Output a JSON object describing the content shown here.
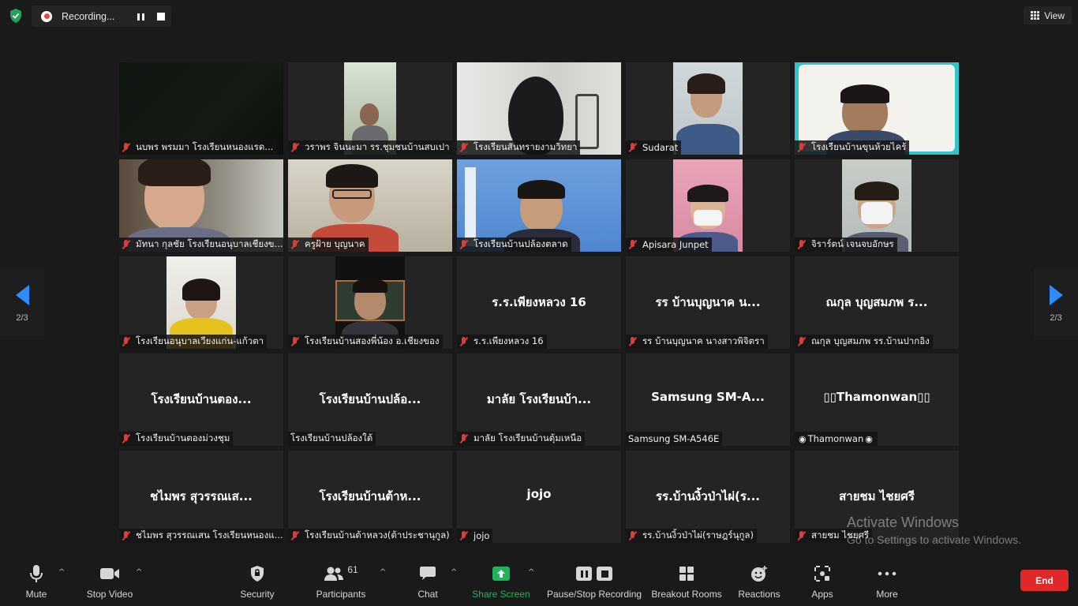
{
  "recording": {
    "label": "Recording..."
  },
  "view": {
    "label": "View"
  },
  "nav": {
    "left_page": "2/3",
    "right_page": "2/3"
  },
  "tiles": [
    {
      "label": "นบพร   พรมมา  โรงเรียนหนองแรด...",
      "big": ""
    },
    {
      "label": "วราพร จินนะมา  รร.ชุมชนบ้านสบเปา",
      "big": ""
    },
    {
      "label": "โรงเรียนสันทรายงามวิทยา",
      "big": ""
    },
    {
      "label": "Sudarat",
      "big": ""
    },
    {
      "label": "โรงเรียนบ้านขุนห้วยไคร้",
      "big": ""
    },
    {
      "label": "มัทนา กุลชัย โรงเรียนอนุบาลเชียงข...",
      "big": ""
    },
    {
      "label": "ครูฝ้าย บุญนาค",
      "big": ""
    },
    {
      "label": "โรงเรียนบ้านปล้องตลาด",
      "big": ""
    },
    {
      "label": "Apisara Junpet",
      "big": ""
    },
    {
      "label": "จิราร์ตน์ เจนจบอักษร",
      "big": ""
    },
    {
      "label": "โรงเรียนอนุบาลเวียงแก่น-แก้วตา",
      "big": ""
    },
    {
      "label": "โรงเรียนบ้านสองพี่น้อง  อ.เชียงของ",
      "big": ""
    },
    {
      "label": "ร.ร.เพียงหลวง 16",
      "big": "ร.ร.เพียงหลวง 16"
    },
    {
      "label": "รร บ้านบุญนาค นางสาวพิจิตรา",
      "big": "รร บ้านบุญนาค น..."
    },
    {
      "label": "ณกุล บุญสมภพ รร.บ้านปากอิง",
      "big": "ณกุล บุญสมภพ ร..."
    },
    {
      "label": "โรงเรียนบ้านตองม่วงชุม",
      "big": "โรงเรียนบ้านตอง..."
    },
    {
      "label": "โรงเรียนบ้านปล้องใต้",
      "big": "โรงเรียนบ้านปล้อ..."
    },
    {
      "label": "มาลัย โรงเรียนบ้านตุ้มเหนือ",
      "big": "มาลัย โรงเรียนบ้า..."
    },
    {
      "label": "Samsung SM-A546E",
      "big": "Samsung  SM-A..."
    },
    {
      "label": "Thamonwan",
      "big": "Thamonwan"
    },
    {
      "label": "ชไมพร สุวรรณเสน โรงเรียนหนองแ...",
      "big": "ชไมพร สุวรรณเส..."
    },
    {
      "label": "โรงเรียนบ้านต้าหลวง(ต้าประชานุกูล)",
      "big": "โรงเรียนบ้านต้าห..."
    },
    {
      "label": "jojo",
      "big": "jojo"
    },
    {
      "label": "รร.บ้านงิ้วป่าไผ่(ราษฎร์นุกูล)",
      "big": "รร.บ้านงิ้วป่าไผ่(ร..."
    },
    {
      "label": "สายชม ไชยศรี",
      "big": "สายชม ไชยศรี"
    }
  ],
  "toolbar": {
    "mute": "Mute",
    "stop_video": "Stop Video",
    "security": "Security",
    "participants": "Participants",
    "participants_count": "61",
    "chat": "Chat",
    "share_screen": "Share Screen",
    "pause_stop_recording": "Pause/Stop Recording",
    "breakout_rooms": "Breakout Rooms",
    "reactions": "Reactions",
    "apps": "Apps",
    "more": "More",
    "end": "End"
  },
  "watermark": {
    "line1": "Activate Windows",
    "line2": "Go to Settings to activate Windows."
  },
  "colors": {
    "accent": "#2d8cff",
    "share_green": "#21b35b",
    "end_red": "#e02828",
    "mic_muted": "#e03a3a"
  }
}
